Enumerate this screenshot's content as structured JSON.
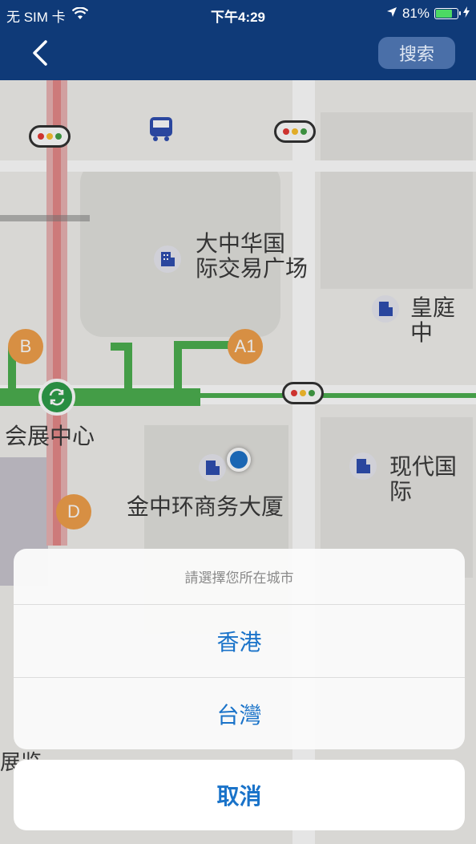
{
  "status_bar": {
    "carrier": "无 SIM 卡",
    "time": "下午4:29",
    "battery_percent": "81%",
    "battery_level": 0.81,
    "icons": [
      "wifi-icon",
      "location-arrow-icon",
      "battery-icon",
      "charging-bolt-icon"
    ]
  },
  "nav": {
    "back_icon": "chevron-left-icon",
    "search_label": "搜索"
  },
  "map": {
    "labels": {
      "plaza": "大中华国\n际交易广场",
      "huangting": "皇庭中",
      "exhibition": "会展中心",
      "jinzhonghuan": "金中环商务大厦",
      "xiandai": "现代国际",
      "bottom_left": "展览"
    },
    "metro_exits": {
      "b": "B",
      "a1": "A1",
      "d": "D"
    },
    "colors": {
      "metro_line": "#4caf50",
      "rail_line": "#e36b6b",
      "exit_badge": "#f0a04b",
      "poi": "#2f4fb0",
      "location": "#1e72c8",
      "nav_bar": "#0f3a78",
      "action_text": "#1a73c9"
    }
  },
  "action_sheet": {
    "title": "請選擇您所在城市",
    "options": [
      "香港",
      "台灣"
    ],
    "cancel": "取消"
  }
}
